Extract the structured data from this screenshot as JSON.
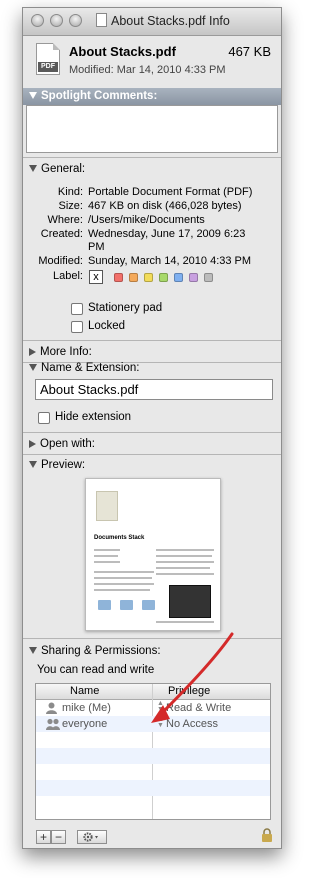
{
  "window": {
    "title": "About Stacks.pdf Info"
  },
  "header": {
    "file_icon_tag": "PDF",
    "filename": "About Stacks.pdf",
    "size": "467 KB",
    "modified": "Modified: Mar 14, 2010 4:33 PM"
  },
  "spotlight": {
    "title": "Spotlight Comments:",
    "value": ""
  },
  "general": {
    "title": "General:",
    "kind_label": "Kind:",
    "kind": "Portable Document Format (PDF)",
    "size_label": "Size:",
    "size": "467 KB on disk (466,028 bytes)",
    "where_label": "Where:",
    "where": "/Users/mike/Documents",
    "created_label": "Created:",
    "created_line1": "Wednesday, June 17, 2009 6:23",
    "created_line2": "PM",
    "modified_label": "Modified:",
    "modified": "Sunday, March 14, 2010 4:33 PM",
    "label_label": "Label:",
    "label_none": "x",
    "label_colors": [
      "#f2706a",
      "#f4a95a",
      "#f2dc5a",
      "#a8d96a",
      "#7fb0f0",
      "#c8a0e0",
      "#bcbcbc"
    ],
    "stationery_label": "Stationery pad",
    "stationery_checked": false,
    "locked_label": "Locked",
    "locked_checked": false
  },
  "more_info": {
    "title": "More Info:"
  },
  "name_ext": {
    "title": "Name & Extension:",
    "name_value": "About Stacks.pdf",
    "hide_ext_label": "Hide extension",
    "hide_ext_checked": false
  },
  "open_with": {
    "title": "Open with:"
  },
  "preview": {
    "title": "Preview:",
    "doc_title": "Documents Stack"
  },
  "sharing": {
    "title": "Sharing & Permissions:",
    "summary": "You can read and write",
    "col_name": "Name",
    "col_privilege": "Privilege",
    "rows": [
      {
        "name": "mike (Me)",
        "privilege": "Read & Write"
      },
      {
        "name": "everyone",
        "privilege": "No Access"
      }
    ]
  },
  "bottom": {
    "add_label": "+",
    "remove_label": "−",
    "gear_icon": "gear-icon",
    "lock_icon": "lock-icon"
  },
  "annotation": {
    "color": "#d42a2a"
  }
}
